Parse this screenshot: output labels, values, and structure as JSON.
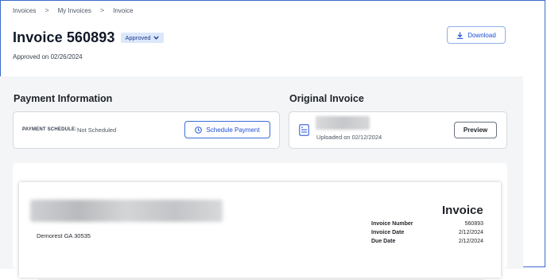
{
  "breadcrumb": {
    "items": [
      "Invoices",
      "My Invoices",
      "Invoice"
    ],
    "separator": ">"
  },
  "header": {
    "title": "Invoice 560893",
    "status": "Approved",
    "approved_text": "Approved on 02/26/2024",
    "download_label": "Download"
  },
  "payment": {
    "section_title": "Payment Information",
    "schedule_label": "PAYMENT SCHEDULE:",
    "schedule_value": "Not Scheduled",
    "schedule_button": "Schedule Payment"
  },
  "original": {
    "section_title": "Original Invoice",
    "uploaded_text": "Uploaded on 02/12/2024",
    "preview_button": "Preview"
  },
  "document": {
    "address_line": "Demorest GA 30535",
    "heading": "Invoice",
    "fields": [
      {
        "label": "Invoice Number",
        "value": "560893"
      },
      {
        "label": "Invoice Date",
        "value": "2/12/2024"
      },
      {
        "label": "Due Date",
        "value": "2/12/2024"
      }
    ]
  },
  "colors": {
    "accent": "#1d4ed8",
    "badge_bg": "#dbe7fb",
    "panel_bg": "#f3f5f7"
  }
}
